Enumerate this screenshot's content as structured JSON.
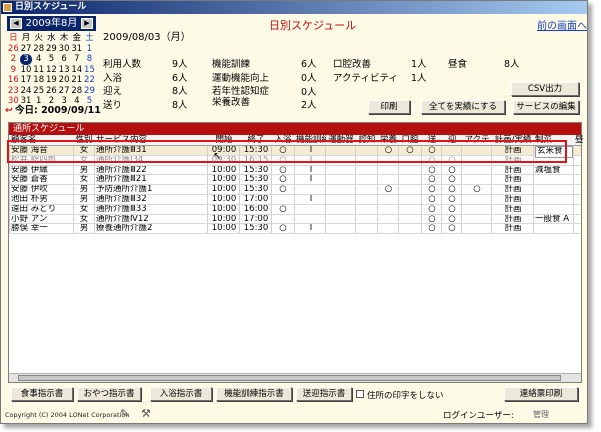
{
  "window": {
    "title": "日別スケジュール"
  },
  "calendar": {
    "month_label": "2009年8月",
    "prev": "◀",
    "next": "▶",
    "weekdays": [
      "日",
      "月",
      "火",
      "水",
      "木",
      "金",
      "土"
    ],
    "weeks": [
      [
        "26",
        "27",
        "28",
        "29",
        "30",
        "31",
        "1"
      ],
      [
        "2",
        "3",
        "4",
        "5",
        "6",
        "7",
        "8"
      ],
      [
        "9",
        "10",
        "11",
        "12",
        "13",
        "14",
        "15"
      ],
      [
        "16",
        "17",
        "18",
        "19",
        "20",
        "21",
        "22"
      ],
      [
        "23",
        "24",
        "25",
        "26",
        "27",
        "28",
        "29"
      ],
      [
        "30",
        "31",
        "1",
        "2",
        "3",
        "4",
        "5"
      ]
    ],
    "selected_day": "3",
    "today_label": "今日: 2009/09/11"
  },
  "header": {
    "date": "2009/08/03（月）",
    "title": "日別スケジュール",
    "back_link": "前の画面へ"
  },
  "stats": [
    {
      "label": "利用人数",
      "value": "9人"
    },
    {
      "label": "入浴",
      "value": "6人"
    },
    {
      "label": "迎え",
      "value": "8人"
    },
    {
      "label": "送り",
      "value": "8人"
    },
    {
      "label": "機能訓練",
      "value": "6人"
    },
    {
      "label": "運動機能向上",
      "value": "0人"
    },
    {
      "label": "若年性認知症",
      "value": "0人"
    },
    {
      "label": "栄養改善",
      "value": "2人"
    },
    {
      "label": "口腔改善",
      "value": "1人"
    },
    {
      "label": "アクティビティ",
      "value": "1人"
    },
    {
      "label": "昼食",
      "value": "8人"
    }
  ],
  "buttons": {
    "print": "印刷",
    "mark_all": "全てを実績にする",
    "csv": "CSV出力",
    "edit_service": "サービスの編集"
  },
  "list": {
    "title": "通所スケジュール",
    "columns": [
      "顧客名",
      "性別",
      "サービス内容",
      "開始",
      "終了",
      "入浴",
      "機能訓練",
      "運動器",
      "認知",
      "栄養",
      "口腔",
      "送",
      "迎",
      "アクテ",
      "計画/実績",
      "制菜",
      "昼"
    ],
    "rows": [
      [
        "安藤 海音",
        "女",
        "通所介護Ⅲ31",
        "09:00",
        "15:30",
        "○",
        "I",
        "",
        "",
        "○",
        "○",
        "○",
        "",
        "",
        "計画",
        "玄米食",
        ""
      ],
      [
        "松井 総四郎",
        "女",
        "通所介護Ⅰ34",
        "09:30",
        "16:15",
        "○",
        "I",
        "",
        "",
        "",
        "",
        "○",
        "○",
        "",
        "計画",
        "",
        ""
      ],
      [
        "安藤 伊織",
        "男",
        "通所介護Ⅲ22",
        "10:00",
        "15:30",
        "○",
        "I",
        "",
        "",
        "",
        "",
        "○",
        "○",
        "",
        "計画",
        "減塩食",
        ""
      ],
      [
        "安藤 蒼香",
        "女",
        "通所介護Ⅲ21",
        "10:00",
        "15:30",
        "○",
        "I",
        "",
        "",
        "",
        "",
        "○",
        "○",
        "",
        "計画",
        "",
        ""
      ],
      [
        "安藤 伊吹",
        "男",
        "予防通所介護1",
        "10:00",
        "15:30",
        "○",
        "",
        "",
        "",
        "○",
        "",
        "○",
        "○",
        "○",
        "計画",
        "",
        ""
      ],
      [
        "池田 朴男",
        "男",
        "通所介護Ⅲ32",
        "10:00",
        "17:00",
        "",
        "I",
        "",
        "",
        "",
        "",
        "○",
        "○",
        "",
        "計画",
        "",
        ""
      ],
      [
        "遠田 みどり",
        "女",
        "通所介護Ⅲ33",
        "10:00",
        "16:00",
        "○",
        "",
        "",
        "",
        "",
        "",
        "○",
        "○",
        "",
        "計画",
        "",
        ""
      ],
      [
        "小野 アン",
        "女",
        "通所介護Ⅳ12",
        "10:00",
        "17:00",
        "",
        "",
        "",
        "",
        "",
        "",
        "○",
        "○",
        "",
        "計画",
        "一般食 A",
        ""
      ],
      [
        "勝俣 幸一",
        "男",
        "療養通所介護2",
        "10:00",
        "15:30",
        "○",
        "I",
        "",
        "",
        "",
        "",
        "○",
        "○",
        "",
        "計画",
        "",
        ""
      ]
    ]
  },
  "bottom_buttons": [
    "食事指示書",
    "おやつ指示書",
    "入浴指示書",
    "機能訓練指示書",
    "送迎指示書"
  ],
  "checkbox_label": "住所の印字をしない",
  "contact_print": "連絡票印刷",
  "copyright": "Copyright (C) 2004 LONet Corporation",
  "login_label": "ログインユーザー:",
  "login_user": "管理"
}
